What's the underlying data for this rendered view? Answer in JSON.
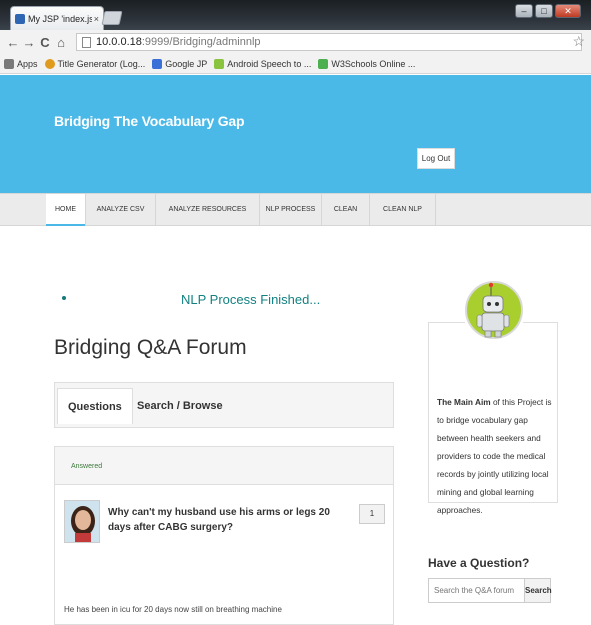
{
  "browser": {
    "tab_title": "My JSP 'index.jsp' starting",
    "tab_close": "×",
    "url_host": "10.0.0.18",
    "url_path": ":9999/Bridging/adminnlp",
    "nav_back": "←",
    "nav_forward": "→",
    "nav_reload": "C",
    "nav_home": "⌂",
    "star": "☆",
    "window_min": "–",
    "window_max": "□",
    "window_close": "✕"
  },
  "bookmarks": [
    {
      "label": "Apps",
      "color": "#7a7a7a"
    },
    {
      "label": "Title Generator (Log...",
      "color": "#e09a1e"
    },
    {
      "label": "Google JP",
      "color": "#3a6fd8"
    },
    {
      "label": "Android Speech to ...",
      "color": "#8ac43f"
    },
    {
      "label": "W3Schools Online ...",
      "color": "#4caf50"
    }
  ],
  "header": {
    "site_title": "Bridging The Vocabulary Gap",
    "logout_label": "Log Out",
    "accent_color": "#4bb9e7"
  },
  "nav": {
    "items": [
      "HOME",
      "ANALYZE CSV",
      "ANALYZE RESOURCES",
      "NLP PROCESS",
      "CLEAN",
      "CLEAN NLP"
    ],
    "active": "HOME"
  },
  "main": {
    "status_message": "NLP Process Finished...",
    "forum_title": "Bridging Q&A Forum",
    "tabs": [
      "Questions",
      "Search / Browse"
    ],
    "question_card": {
      "status": "Answered",
      "question": "Why can't my husband use his arms or legs 20 days after CABG surgery?",
      "count": "1",
      "snippet": "He has been in icu for 20 days now still on breathing machine"
    }
  },
  "sidebar": {
    "about_bold": "The Main Aim",
    "about_text": " of this Project is to bridge vocabulary gap between health seekers and providers to code the medical records by jointly utilizing local mining and global learning approaches.",
    "have_question": "Have a Question?",
    "search_placeholder": "Search the Q&A forum",
    "search_button": "Search"
  }
}
